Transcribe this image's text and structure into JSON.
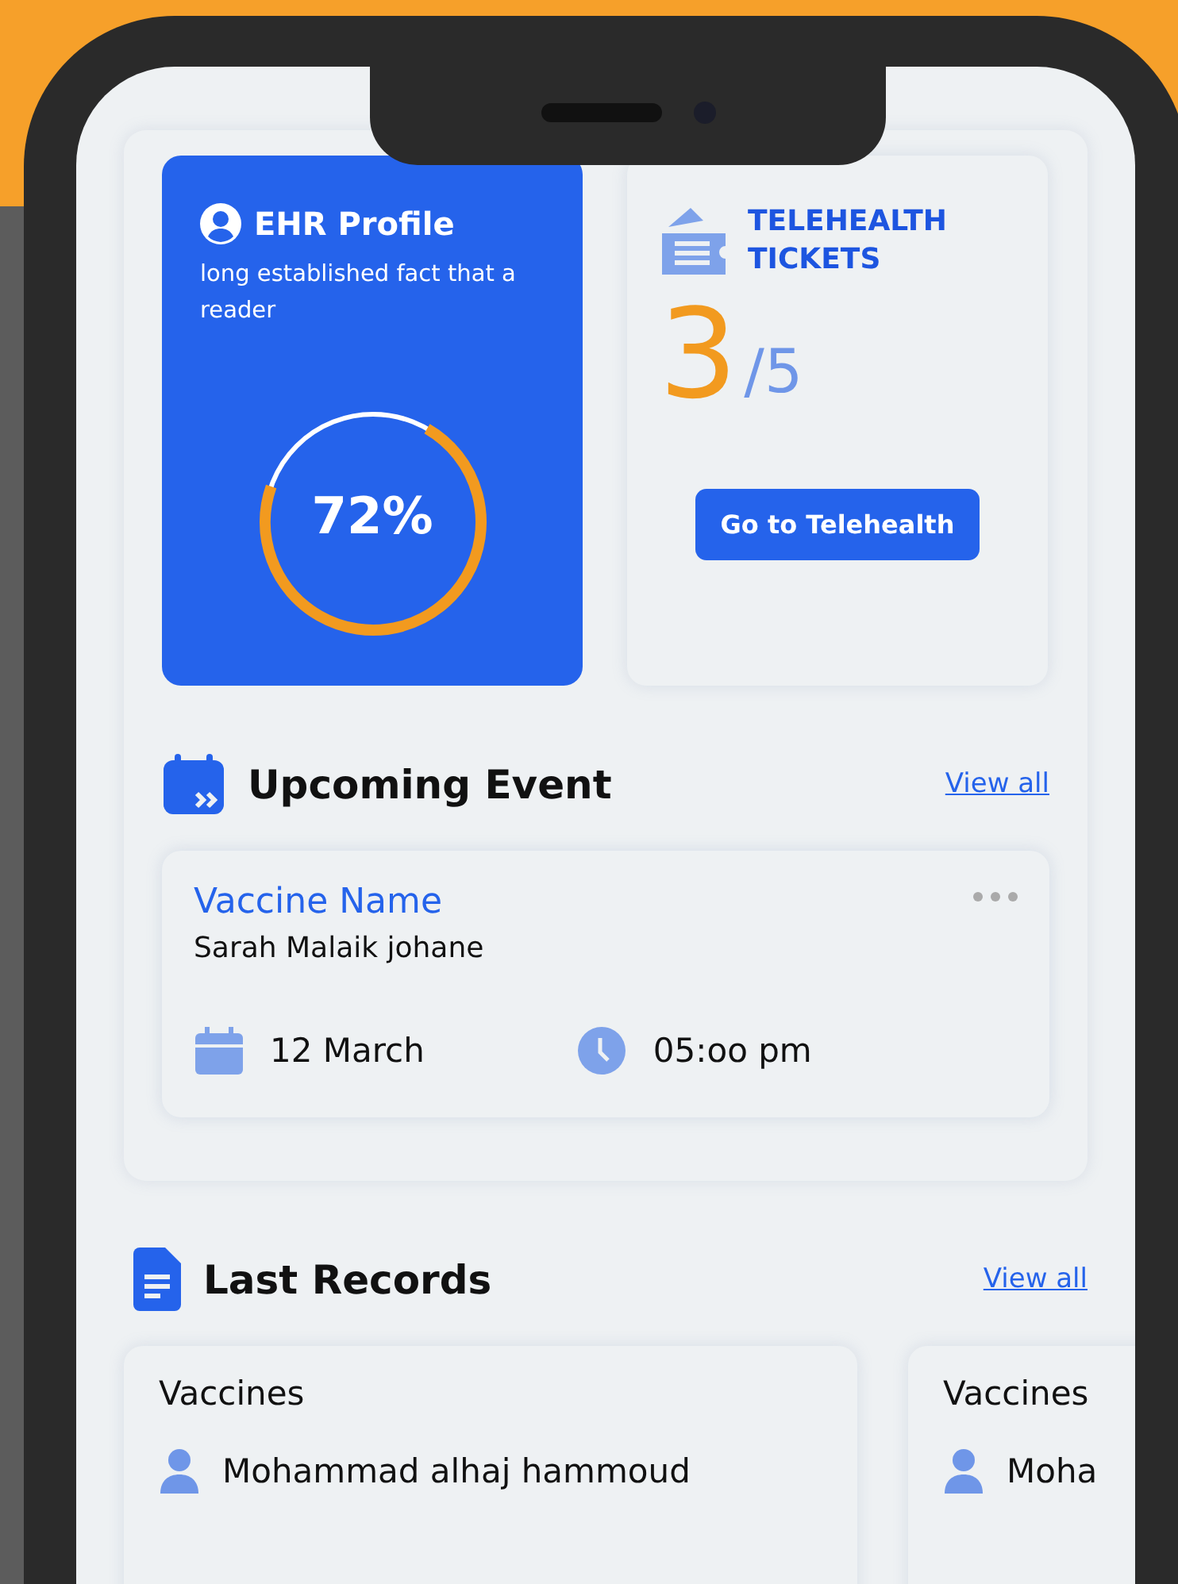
{
  "profile_card": {
    "title": "EHR Profile",
    "description": "long established fact that a reader",
    "progress": {
      "label": "72%",
      "level": 0.72
    }
  },
  "telehealth_card": {
    "title_lines": [
      "TELEHEALTH",
      "TICKETS"
    ],
    "used": "3",
    "total": "/5",
    "button": "Go to Telehealth"
  },
  "upcoming_event": {
    "heading": "Upcoming Event",
    "view_all": "View all",
    "event": {
      "name": "Vaccine Name",
      "person": "Sarah Malaik johane",
      "date": "12 March",
      "time": "05:oo pm"
    }
  },
  "last_records": {
    "heading": "Last Records",
    "view_all": "View all",
    "records": [
      {
        "type": "Vaccines",
        "person": "Mohammad alhaj hammoud"
      },
      {
        "type": "Vaccines",
        "person": "Moha"
      }
    ]
  }
}
